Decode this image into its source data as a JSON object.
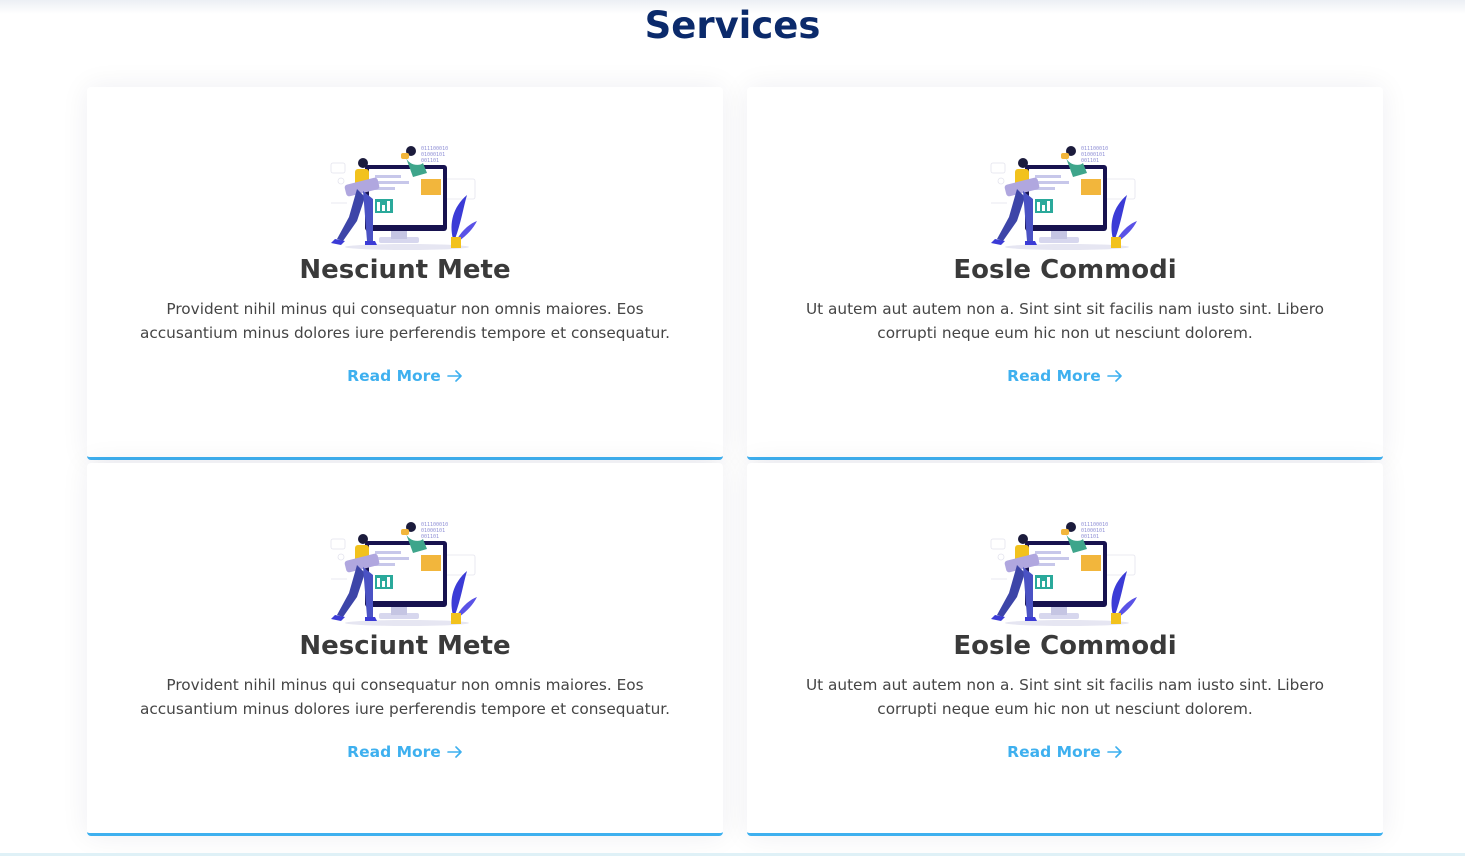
{
  "section": {
    "title": "Services"
  },
  "cards": [
    {
      "title": "Nesciunt Mete",
      "description": "Provident nihil minus qui consequatur non omnis maiores. Eos accusantium minus dolores iure perferendis tempore et consequatur.",
      "link_label": "Read More"
    },
    {
      "title": "Eosle Commodi",
      "description": "Ut autem aut autem non a. Sint sint sit facilis nam iusto sint. Libero corrupti neque eum hic non ut nesciunt dolorem.",
      "link_label": "Read More"
    },
    {
      "title": "Nesciunt Mete",
      "description": "Provident nihil minus qui consequatur non omnis maiores. Eos accusantium minus dolores iure perferendis tempore et consequatur.",
      "link_label": "Read More"
    },
    {
      "title": "Eosle Commodi",
      "description": "Ut autem aut autem non a. Sint sint sit facilis nam iusto sint. Libero corrupti neque eum hic non ut nesciunt dolorem.",
      "link_label": "Read More"
    }
  ],
  "illustration": {
    "icon": "developers-at-computer-illustration",
    "binary_lines": [
      "011100010",
      "01000101",
      "001101"
    ]
  },
  "colors": {
    "title": "#0b2a6b",
    "accent": "#3eb0ef",
    "card_title": "#3a3a3a",
    "body_text": "#454545"
  }
}
